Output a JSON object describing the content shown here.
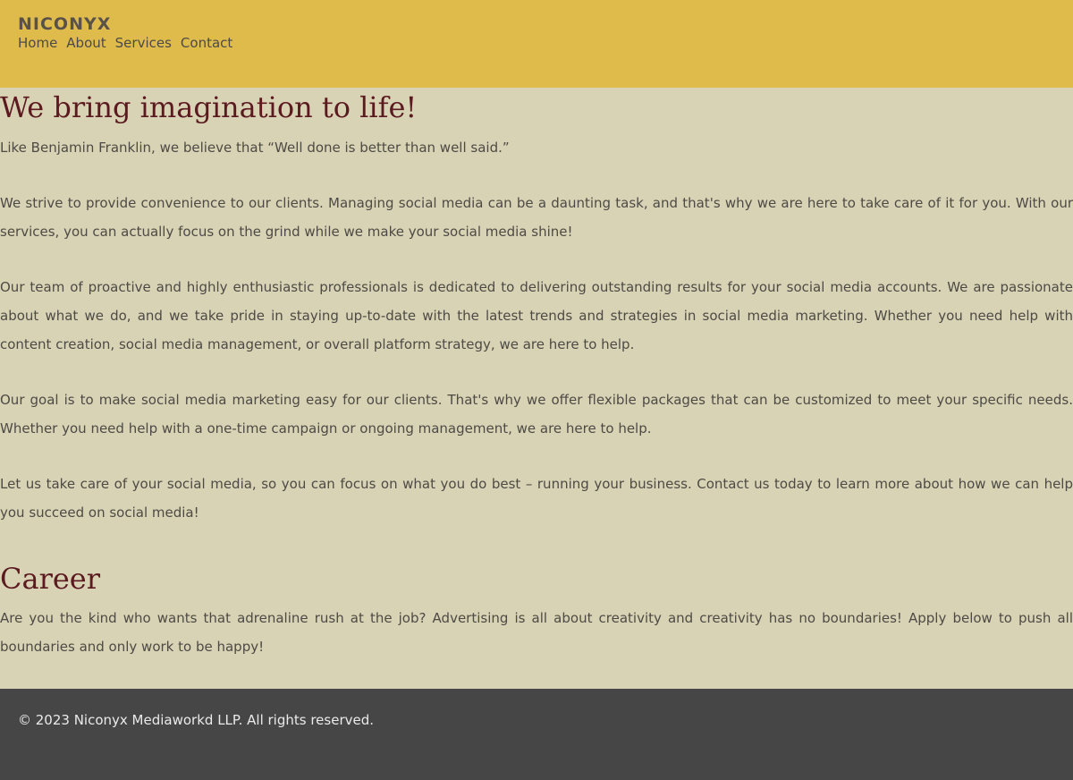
{
  "header": {
    "logo": "NICONYX",
    "nav": [
      {
        "label": "Home"
      },
      {
        "label": "About"
      },
      {
        "label": "Services"
      },
      {
        "label": "Contact"
      }
    ]
  },
  "main": {
    "title": "We bring imagination to life!",
    "paragraphs": [
      "Like Benjamin Franklin, we believe that “Well done is better than well said.”",
      "We strive to provide convenience to our clients. Managing social media can be a daunting task, and that's why we are here to take care of it for you. With our services, you can actually focus on the grind while we make your social media shine!",
      "Our team of proactive and highly enthusiastic professionals is dedicated to delivering outstanding results for your social media accounts. We are passionate about what we do, and we take pride in staying up-to-date with the latest trends and strategies in social media marketing. Whether you need help with content creation, social media management, or overall platform strategy, we are here to help.",
      "Our goal is to make social media marketing easy for our clients. That's why we offer flexible packages that can be customized to meet your specific needs. Whether you need help with a one-time campaign or ongoing management, we are here to help.",
      "Let us take care of your social media, so you can focus on what you do best – running your business. Contact us today to learn more about how we can help you succeed on social media!"
    ],
    "career": {
      "heading": "Career",
      "text": "Are you the kind who wants that adrenaline rush at the job? Advertising is all about creativity and creativity has no boundaries! Apply below to push all boundaries and only work to be happy!"
    }
  },
  "footer": {
    "copyright": "© 2023 Niconyx Mediaworkd LLP. All rights reserved."
  },
  "colors": {
    "header_bg": "#dfbb4c",
    "page_bg": "#d9d3b5",
    "heading": "#5b1a1f",
    "text": "#4d4a45",
    "footer_bg": "#464646"
  }
}
